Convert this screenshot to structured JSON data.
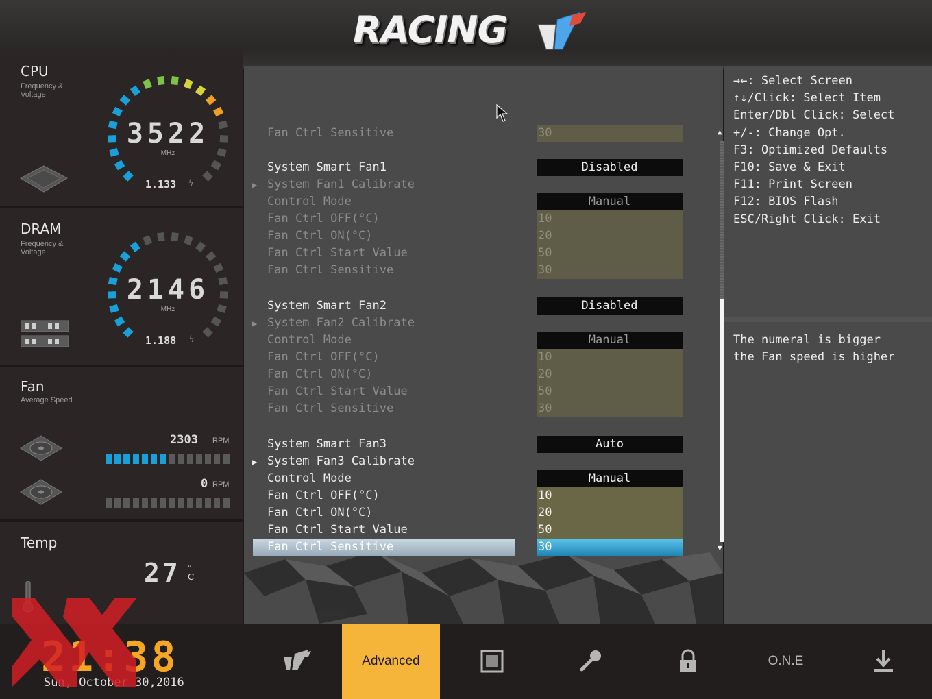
{
  "header": {
    "logo_text": "RACING"
  },
  "sidebar": {
    "cpu": {
      "title": "CPU",
      "subtitle": "Frequency & Voltage",
      "value": "3522",
      "unit": "MHz",
      "voltage": "1.133"
    },
    "dram": {
      "title": "DRAM",
      "subtitle": "Frequency & Voltage",
      "value": "2146",
      "unit": "MHz",
      "voltage": "1.188"
    },
    "fan": {
      "title": "Fan",
      "subtitle": "Average Speed",
      "fan1_rpm": "2303",
      "fan2_rpm": "0",
      "rpm_unit": "RPM",
      "fan1_level": 0.5,
      "fan2_level": 0.0
    },
    "temp": {
      "title": "Temp",
      "value": "27",
      "unit": "°C"
    }
  },
  "settings": {
    "rows": [
      {
        "label": "Fan Ctrl Sensitive",
        "value": "30",
        "style": "dim",
        "vstyle": "olive-dim"
      },
      {
        "label": "System Smart Fan1",
        "value": "Disabled",
        "style": "bright",
        "vstyle": "dark"
      },
      {
        "label": "System Fan1 Calibrate",
        "value": "",
        "style": "dim",
        "vstyle": "none",
        "arrow": true
      },
      {
        "label": "Control Mode",
        "value": "Manual",
        "style": "dim",
        "vstyle": "dark-dim"
      },
      {
        "label": "Fan Ctrl OFF(°C)",
        "value": "10",
        "style": "dim",
        "vstyle": "olive-dim"
      },
      {
        "label": "Fan Ctrl ON(°C)",
        "value": "20",
        "style": "dim",
        "vstyle": "olive-dim"
      },
      {
        "label": "Fan Ctrl Start Value",
        "value": "50",
        "style": "dim",
        "vstyle": "olive-dim"
      },
      {
        "label": "Fan Ctrl Sensitive",
        "value": "30",
        "style": "dim",
        "vstyle": "olive-dim"
      },
      {
        "label": "System Smart Fan2",
        "value": "Disabled",
        "style": "bright",
        "vstyle": "dark"
      },
      {
        "label": "System Fan2 Calibrate",
        "value": "",
        "style": "dim",
        "vstyle": "none",
        "arrow": true
      },
      {
        "label": "Control Mode",
        "value": "Manual",
        "style": "dim",
        "vstyle": "dark-dim"
      },
      {
        "label": "Fan Ctrl OFF(°C)",
        "value": "10",
        "style": "dim",
        "vstyle": "olive-dim"
      },
      {
        "label": "Fan Ctrl ON(°C)",
        "value": "20",
        "style": "dim",
        "vstyle": "olive-dim"
      },
      {
        "label": "Fan Ctrl Start Value",
        "value": "50",
        "style": "dim",
        "vstyle": "olive-dim"
      },
      {
        "label": "Fan Ctrl Sensitive",
        "value": "30",
        "style": "dim",
        "vstyle": "olive-dim"
      },
      {
        "label": "System Smart Fan3",
        "value": "Auto",
        "style": "bright",
        "vstyle": "dark"
      },
      {
        "label": "System Fan3 Calibrate",
        "value": "",
        "style": "bright",
        "vstyle": "none",
        "arrow": true
      },
      {
        "label": "Control Mode",
        "value": "Manual",
        "style": "bright",
        "vstyle": "dark"
      },
      {
        "label": "Fan Ctrl OFF(°C)",
        "value": "10",
        "style": "bright",
        "vstyle": "olive"
      },
      {
        "label": "Fan Ctrl ON(°C)",
        "value": "20",
        "style": "bright",
        "vstyle": "olive"
      },
      {
        "label": "Fan Ctrl Start Value",
        "value": "50",
        "style": "bright",
        "vstyle": "olive"
      },
      {
        "label": "Fan Ctrl Sensitive",
        "value": "30",
        "style": "sel",
        "vstyle": "selv"
      }
    ]
  },
  "help": {
    "keys": [
      "→←: Select Screen",
      "↑↓/Click: Select Item",
      "Enter/Dbl Click: Select",
      "+/-: Change Opt.",
      "F3: Optimized Defaults",
      "F10: Save & Exit",
      "F11: Print Screen",
      "F12: BIOS Flash",
      "ESC/Right Click: Exit"
    ],
    "description": [
      "The numeral is bigger",
      "the Fan speed is higher"
    ]
  },
  "bottom": {
    "time": "21:38",
    "date": "Sun, October  30,2016",
    "nav": [
      {
        "icon": "racing-logo-icon",
        "label": ""
      },
      {
        "icon": "",
        "label": "Advanced",
        "active": true
      },
      {
        "icon": "chip-icon",
        "label": ""
      },
      {
        "icon": "tool-icon",
        "label": ""
      },
      {
        "icon": "lock-icon",
        "label": ""
      },
      {
        "icon": "",
        "label": "O.N.E"
      },
      {
        "icon": "download-icon",
        "label": ""
      }
    ]
  },
  "colors": {
    "accent": "#f5b43a",
    "clock": "#f5a623",
    "selected": "#2ea0d0",
    "olive": "#6a6747"
  }
}
